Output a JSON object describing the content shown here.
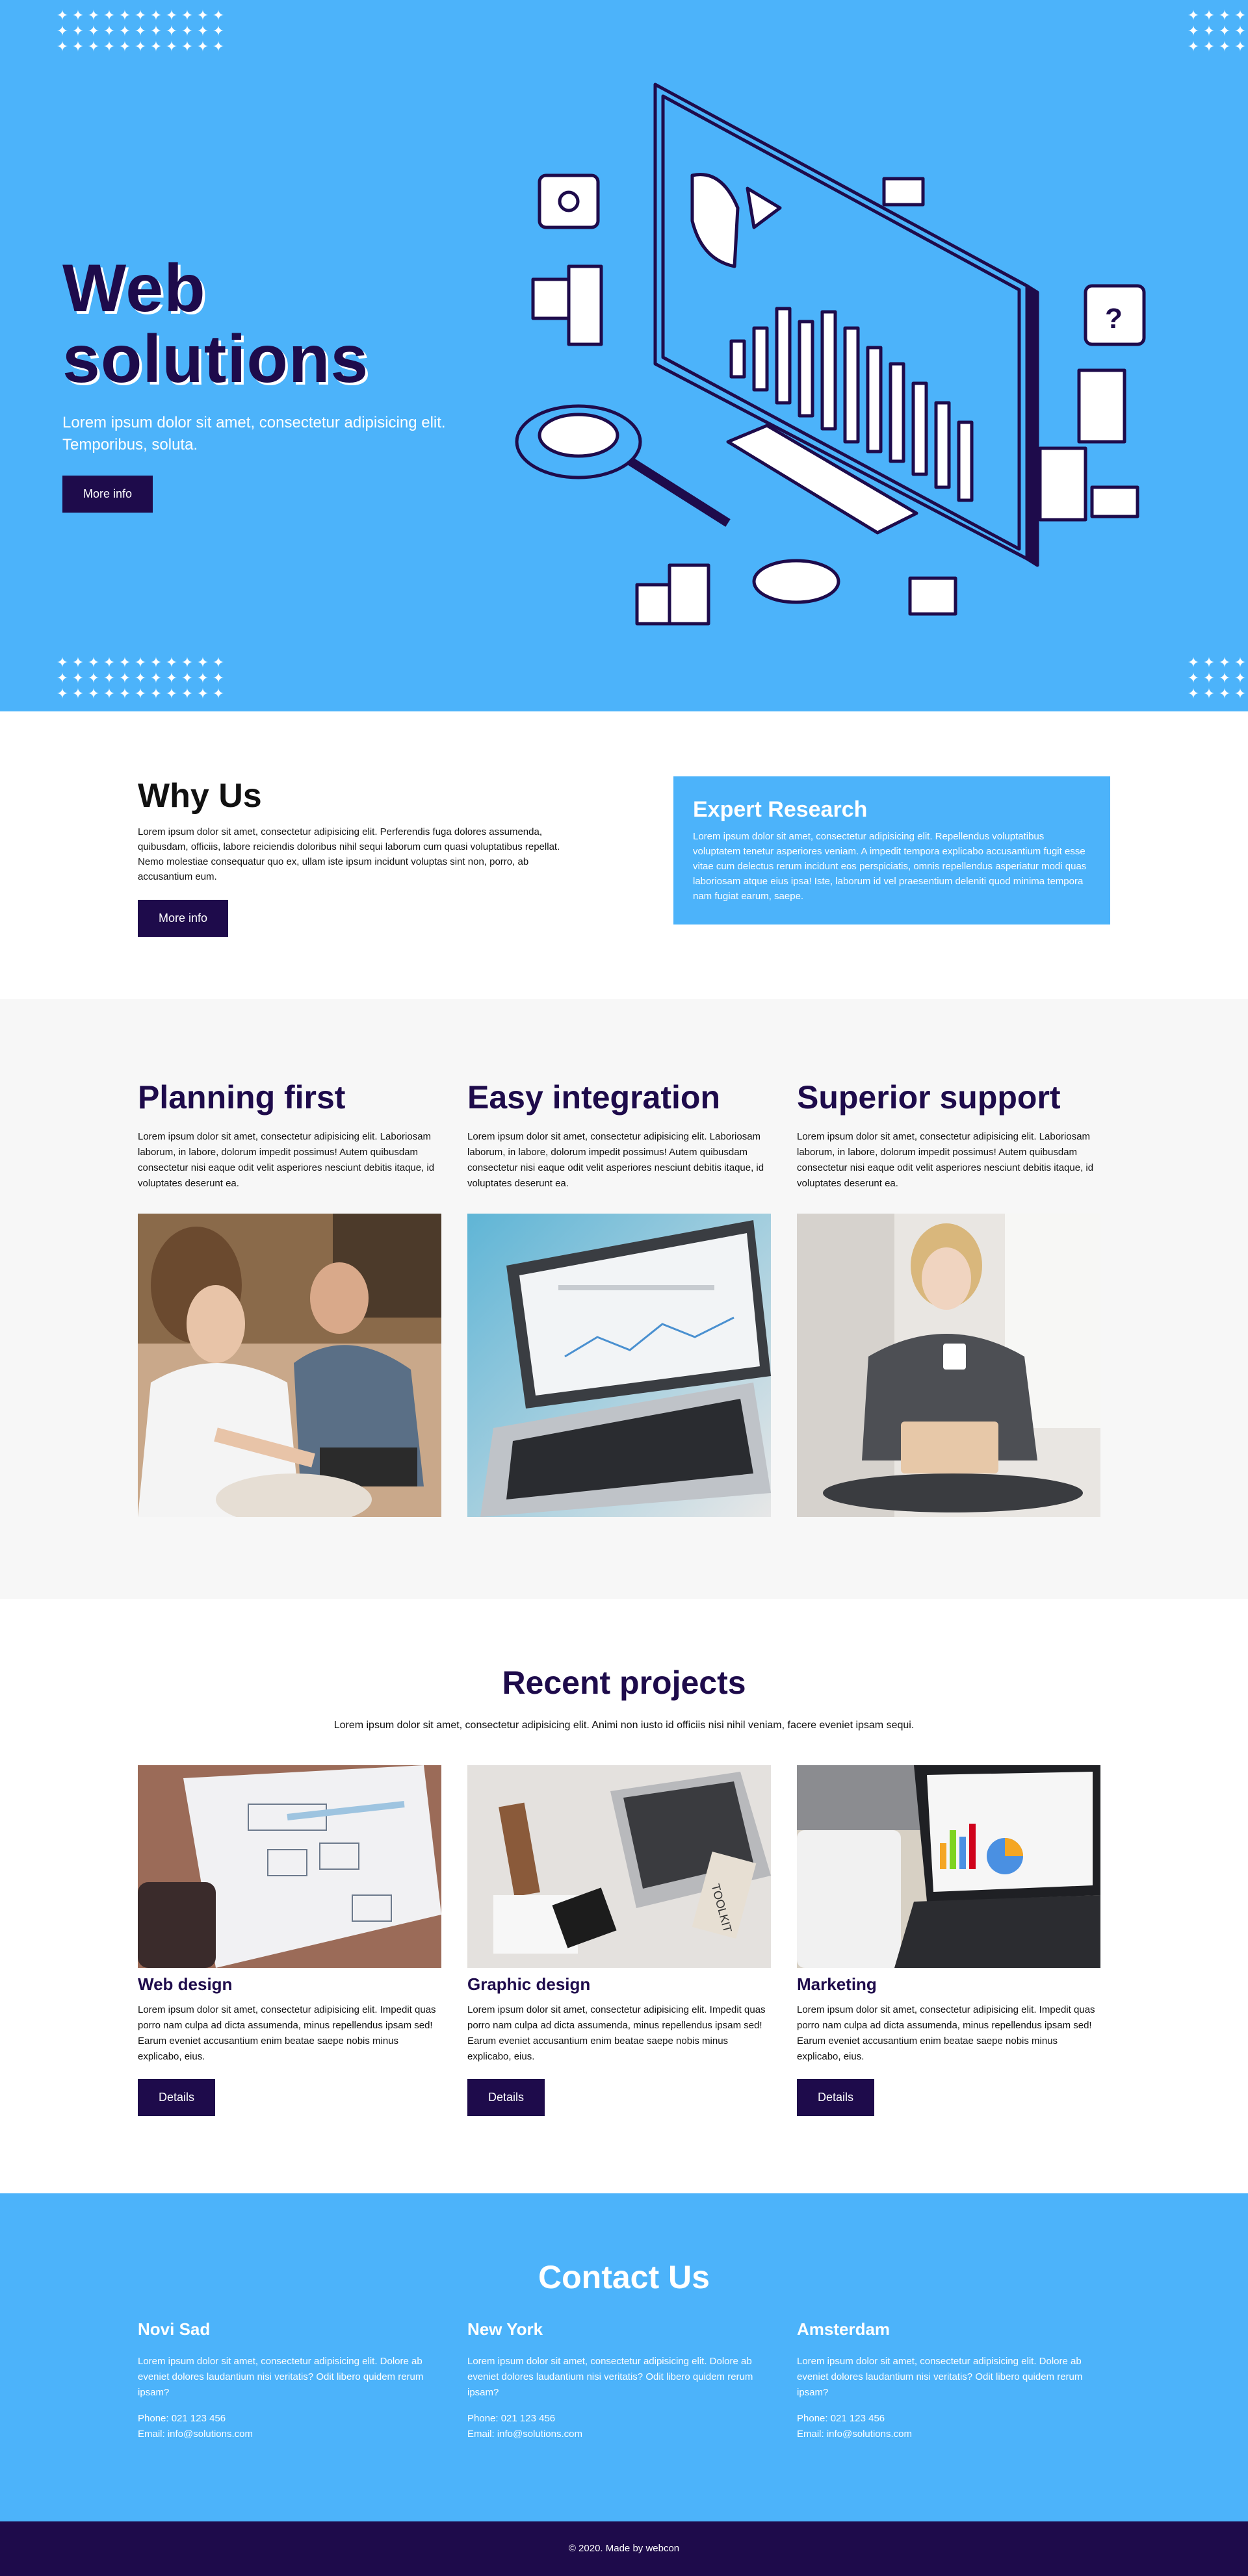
{
  "hero": {
    "title": "Web solutions",
    "subtitle": "Lorem ipsum dolor sit amet, consectetur adipisicing elit. Temporibus, soluta.",
    "button": "More info",
    "illustration": "isometric-monitor-analytics-illustration"
  },
  "why": {
    "title": "Why Us",
    "text": "Lorem ipsum dolor sit amet, consectetur adipisicing elit. Perferendis fuga dolores assumenda, quibusdam, officiis, labore reiciendis doloribus nihil sequi laborum cum quasi voluptatibus repellat. Nemo molestiae consequatur quo ex, ullam iste ipsum incidunt voluptas sint non, porro, ab accusantium eum.",
    "button": "More info",
    "box_title": "Expert Research",
    "box_text": "Lorem ipsum dolor sit amet, consectetur adipisicing elit. Repellendus voluptatibus voluptatem tenetur asperiores veniam. A impedit tempora explicabo accusantium fugit esse vitae cum delectus rerum incidunt eos perspiciatis, omnis repellendus asperiatur modi quas laboriosam atque eius ipsa! Iste, laborum id vel praesentium deleniti quod minima tempora nam fugiat earum, saepe."
  },
  "features": [
    {
      "title": "Planning first",
      "text": "Lorem ipsum dolor sit amet, consectetur adipisicing elit. Laboriosam laborum, in labore, dolorum impedit possimus! Autem quibusdam consectetur nisi eaque odit velit asperiores nesciunt debitis itaque, id voluptates deserunt ea.",
      "image": "people-working-laptops-photo"
    },
    {
      "title": "Easy integration",
      "text": "Lorem ipsum dolor sit amet, consectetur adipisicing elit. Laboriosam laborum, in labore, dolorum impedit possimus! Autem quibusdam consectetur nisi eaque odit velit asperiores nesciunt debitis itaque, id voluptates deserunt ea.",
      "image": "laptop-analytics-photo"
    },
    {
      "title": "Superior support",
      "text": "Lorem ipsum dolor sit amet, consectetur adipisicing elit. Laboriosam laborum, in labore, dolorum impedit possimus! Autem quibusdam consectetur nisi eaque odit velit asperiores nesciunt debitis itaque, id voluptates deserunt ea.",
      "image": "woman-with-laptop-photo"
    }
  ],
  "projects": {
    "title": "Recent projects",
    "subtitle": "Lorem ipsum dolor sit amet, consectetur adipisicing elit. Animi non iusto id officiis nisi nihil veniam, facere eveniet ipsam sequi.",
    "items": [
      {
        "title": "Web design",
        "text": "Lorem ipsum dolor sit amet, consectetur adipisicing elit. Impedit quas porro nam culpa ad dicta assumenda, minus repellendus ipsam sed! Earum eveniet accusantium enim beatae saepe nobis minus explicabo, eius.",
        "button": "Details",
        "image": "wireframe-notebook-photo"
      },
      {
        "title": "Graphic design",
        "text": "Lorem ipsum dolor sit amet, consectetur adipisicing elit. Impedit quas porro nam culpa ad dicta assumenda, minus repellendus ipsam sed! Earum eveniet accusantium enim beatae saepe nobis minus explicabo, eius.",
        "button": "Details",
        "image": "design-desk-toolkit-photo",
        "image_text": "TOOLKIT"
      },
      {
        "title": "Marketing",
        "text": "Lorem ipsum dolor sit amet, consectetur adipisicing elit. Impedit quas porro nam culpa ad dicta assumenda, minus repellendus ipsam sed! Earum eveniet accusantium enim beatae saepe nobis minus explicabo, eius.",
        "button": "Details",
        "image": "laptop-charts-tablet-photo"
      }
    ]
  },
  "contact": {
    "title": "Contact Us",
    "offices": [
      {
        "city": "Novi Sad",
        "text": "Lorem ipsum dolor sit amet, consectetur adipisicing elit. Dolore ab eveniet dolores laudantium nisi veritatis? Odit libero quidem rerum ipsam?",
        "phone": "Phone: 021 123 456",
        "email": "Email: info@solutions.com"
      },
      {
        "city": "New York",
        "text": "Lorem ipsum dolor sit amet, consectetur adipisicing elit. Dolore ab eveniet dolores laudantium nisi veritatis? Odit libero quidem rerum ipsam?",
        "phone": "Phone: 021 123 456",
        "email": "Email: info@solutions.com"
      },
      {
        "city": "Amsterdam",
        "text": "Lorem ipsum dolor sit amet, consectetur adipisicing elit. Dolore ab eveniet dolores laudantium nisi veritatis? Odit libero quidem rerum ipsam?",
        "phone": "Phone: 021 123 456",
        "email": "Email: info@solutions.com"
      }
    ]
  },
  "footer": {
    "text": "© 2020. Made by webcon"
  },
  "colors": {
    "primary": "#4cb3fa",
    "dark": "#1e0b4b",
    "light_bg": "#f7f7f7",
    "white": "#ffffff"
  }
}
